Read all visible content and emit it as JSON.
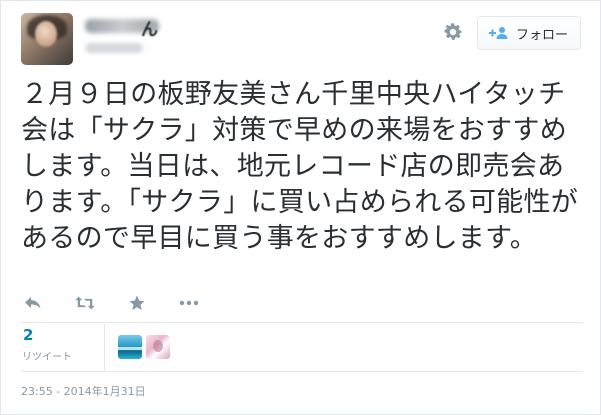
{
  "header": {
    "name_tail": "ん",
    "follow_label": "フォロー",
    "icons": {
      "gear": "gear-icon",
      "follow": "person-plus-icon"
    }
  },
  "tweet": {
    "text": "２月９日の板野友美さん千里中央ハイタッチ会は「サクラ」対策で早めの来場をおすすめします。当日は、地元レコード店の即売会あります。「サクラ」に買い占められる可能性があるので早目に買う事をおすすめします。"
  },
  "actions": [
    {
      "name": "reply-icon"
    },
    {
      "name": "retweet-icon"
    },
    {
      "name": "favorite-star-icon"
    },
    {
      "name": "more-dots-icon"
    }
  ],
  "stats": {
    "retweet_count": "2",
    "retweet_label": "リツイート"
  },
  "timestamp": "23:55 - 2014年1月31日",
  "colors": {
    "accent": "#0084b4",
    "muted": "#8899a6",
    "border": "#e1e8ed",
    "text": "#292f33"
  }
}
